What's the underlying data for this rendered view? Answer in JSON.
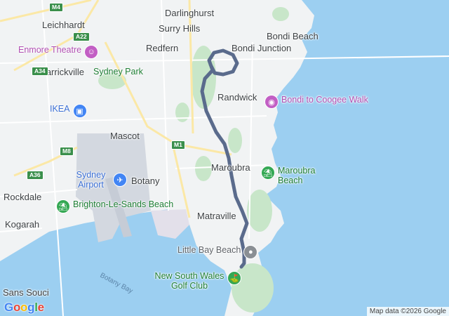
{
  "map": {
    "suburbs": [
      {
        "id": "darlinghurst",
        "name": "Darlinghurst"
      },
      {
        "id": "leichhardt",
        "name": "Leichhardt"
      },
      {
        "id": "surry-hills",
        "name": "Surry Hills"
      },
      {
        "id": "bondi-beach",
        "name": "Bondi Beach"
      },
      {
        "id": "redfern",
        "name": "Redfern"
      },
      {
        "id": "bondi-junction",
        "name": "Bondi Junction"
      },
      {
        "id": "marrickville",
        "name": "Marrickville"
      },
      {
        "id": "randwick",
        "name": "Randwick"
      },
      {
        "id": "mascot",
        "name": "Mascot"
      },
      {
        "id": "maroubra",
        "name": "Maroubra"
      },
      {
        "id": "botany",
        "name": "Botany"
      },
      {
        "id": "rockdale",
        "name": "Rockdale"
      },
      {
        "id": "matraville",
        "name": "Matraville"
      },
      {
        "id": "kogarah",
        "name": "Kogarah"
      },
      {
        "id": "sans-souci",
        "name": "Sans Souci"
      }
    ],
    "pois": [
      {
        "id": "enmore-theatre",
        "name": "Enmore Theatre",
        "icon": "theatre-icon",
        "color": "#c25fc4"
      },
      {
        "id": "sydney-park",
        "name": "Sydney Park",
        "icon": "",
        "color": "#1e7e34"
      },
      {
        "id": "ikea",
        "name": "IKEA",
        "icon": "shopping-bag-icon",
        "color": "#4285f4"
      },
      {
        "id": "bondi-coogee",
        "name": "Bondi to Coogee Walk",
        "icon": "camera-icon",
        "color": "#c25fc4"
      },
      {
        "id": "sydney-airport",
        "name": "Sydney Airport",
        "icon": "airplane-icon",
        "color": "#4285f4"
      },
      {
        "id": "maroubra-beach",
        "name": "Maroubra Beach",
        "icon": "beach-icon",
        "color": "#34a853"
      },
      {
        "id": "brighton-le-sands",
        "name": "Brighton-Le-Sands Beach",
        "icon": "beach-icon",
        "color": "#34a853"
      },
      {
        "id": "little-bay",
        "name": "Little Bay Beach",
        "icon": "location-icon",
        "color": "#8a8f94"
      },
      {
        "id": "nsw-golf",
        "name": "New South Wales Golf Club",
        "icon": "golf-icon",
        "color": "#34a853"
      }
    ],
    "roads": [
      {
        "id": "m4",
        "label": "M4"
      },
      {
        "id": "a22",
        "label": "A22"
      },
      {
        "id": "a34",
        "label": "A34"
      },
      {
        "id": "m1",
        "label": "M1"
      },
      {
        "id": "m8",
        "label": "M8"
      },
      {
        "id": "a36",
        "label": "A36"
      }
    ],
    "water_labels": [
      {
        "id": "botany-bay",
        "name": "Botany Bay"
      }
    ],
    "route": {
      "color": "#5a6b8c"
    },
    "colors": {
      "water": "#9ccff1",
      "land": "#f1f3f4",
      "park": "#c8e6c9"
    }
  },
  "branding": {
    "logo": "Google"
  },
  "attribution": "Map data ©2026 Google"
}
